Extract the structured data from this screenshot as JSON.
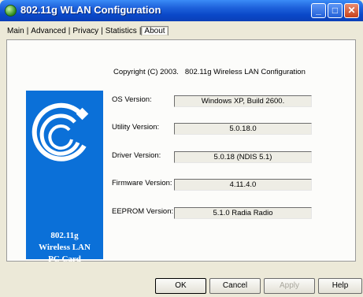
{
  "window": {
    "title": "802.11g WLAN Configuration",
    "minimize_glyph": "_",
    "maximize_glyph": "□",
    "close_glyph": "✕"
  },
  "tabs": [
    {
      "label": "Main",
      "active": false
    },
    {
      "label": "Advanced",
      "active": false
    },
    {
      "label": "Privacy",
      "active": false
    },
    {
      "label": "Statistics",
      "active": false
    },
    {
      "label": "About",
      "active": true
    }
  ],
  "about": {
    "copyright": "Copyright (C) 2003.",
    "product": "802.11g Wireless LAN Configuration",
    "logo_lines": [
      "802.11g",
      "Wireless LAN",
      "PC Card"
    ],
    "rows": [
      {
        "label": "OS Version:",
        "value": "Windows XP, Build 2600."
      },
      {
        "label": "Utility Version:",
        "value": "5.0.18.0"
      },
      {
        "label": "Driver Version:",
        "value": "5.0.18 (NDIS 5.1)"
      },
      {
        "label": "Firmware Version:",
        "value": "4.11.4.0"
      },
      {
        "label": "EEPROM Version:",
        "value": "5.1.0  Radia Radio"
      }
    ]
  },
  "buttons": {
    "ok": "OK",
    "cancel": "Cancel",
    "apply": "Apply",
    "help": "Help"
  },
  "colors": {
    "titlebar": "#0a48c8",
    "logo_background": "#0b70d8",
    "dialog_background": "#ece9d8"
  },
  "icons": {
    "app": "wireless-globe-icon",
    "logo": "wireless-waves-logo"
  }
}
